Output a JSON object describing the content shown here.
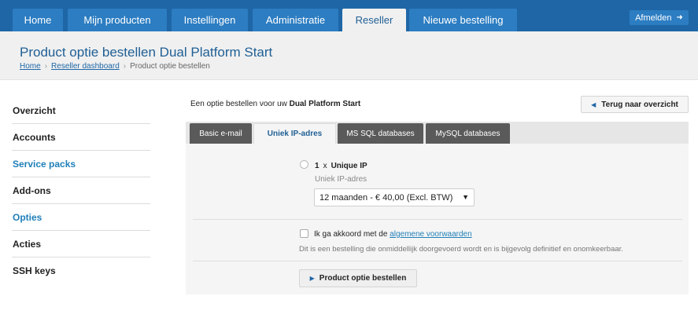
{
  "nav": {
    "tabs": [
      {
        "label": "Home"
      },
      {
        "label": "Mijn producten"
      },
      {
        "label": "Instellingen"
      },
      {
        "label": "Administratie"
      },
      {
        "label": "Reseller"
      },
      {
        "label": "Nieuwe bestelling"
      }
    ],
    "active": "Reseller",
    "logout_label": "Afmelden",
    "logout_icon": "arrow-right-icon"
  },
  "header": {
    "title": "Product optie bestellen Dual Platform Start",
    "breadcrumb": [
      {
        "label": "Home"
      },
      {
        "label": "Reseller dashboard"
      },
      {
        "label": "Product optie bestellen"
      }
    ],
    "separator": "›"
  },
  "sidebar": {
    "items": [
      {
        "label": "Overzicht"
      },
      {
        "label": "Accounts"
      },
      {
        "label": "Service packs"
      },
      {
        "label": "Add-ons"
      },
      {
        "label": "Opties"
      },
      {
        "label": "Acties"
      },
      {
        "label": "SSH keys"
      }
    ]
  },
  "main": {
    "intro_prefix": "Een optie bestellen voor uw",
    "intro_product": "Dual Platform Start",
    "back_label": "Terug naar overzicht",
    "option_tabs": [
      {
        "label": "Basic e-mail"
      },
      {
        "label": "Uniek IP-adres"
      },
      {
        "label": "MS SQL databases"
      },
      {
        "label": "MySQL databases"
      }
    ],
    "active_tab": "Uniek IP-adres",
    "option": {
      "quantity": "1",
      "times": "x",
      "name": "Unique IP",
      "sublabel": "Uniek IP-adres",
      "selected_period": "12 maanden - € 40,00 (Excl. BTW)"
    },
    "agree_prefix": "Ik ga akkoord met de",
    "agree_link": "algemene voorwaarden",
    "disclaimer": "Dit is een bestelling die onmiddellijk doorgevoerd wordt en is bijgevolg definitief en onomkeerbaar.",
    "order_label": "Product optie bestellen"
  },
  "colors": {
    "nav_bg": "#1f66a6",
    "tab_bg": "#2c7dc2",
    "link": "#1f7fb8",
    "title": "#1f5f95",
    "option_tab_bg": "#5a5a5a"
  }
}
